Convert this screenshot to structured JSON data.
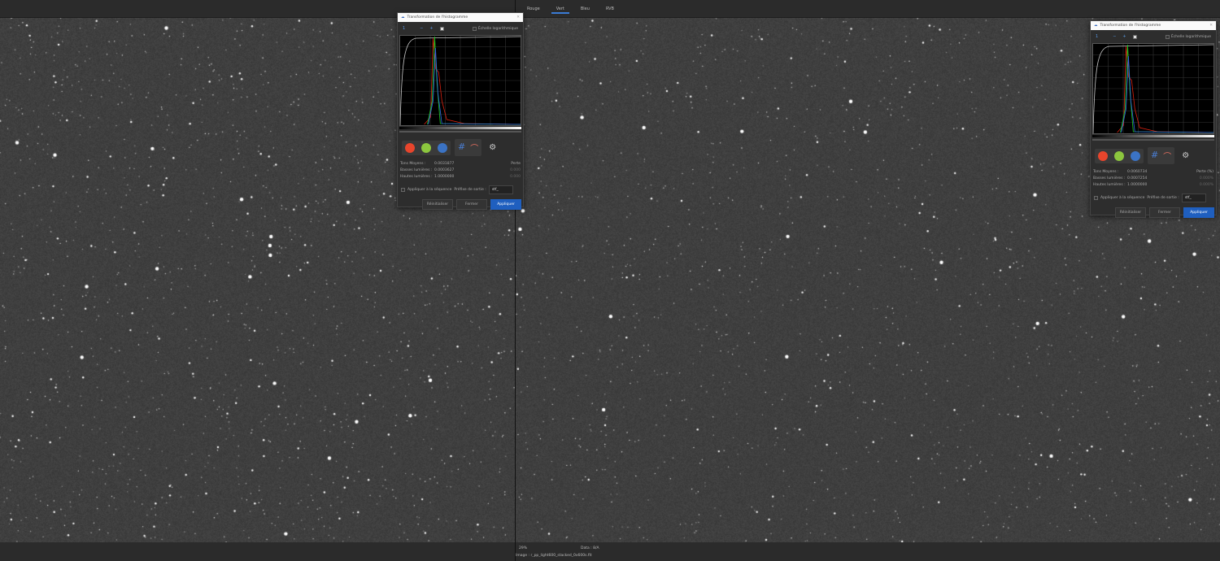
{
  "channel_tabs": [
    "Rouge",
    "Vert",
    "Bleu",
    "RVB"
  ],
  "active_tab": "Vert",
  "status": {
    "zoom": "29%",
    "data": "Data : ",
    "data_value": "8/A",
    "image": "Image : r_pp_light600_stacked_0x600s.fit"
  },
  "dialogs": [
    {
      "title": "Transformation de l'histogramme",
      "zoom_value": "1",
      "log_scale_label": "Échelle logarithmique",
      "stats": [
        {
          "label": "Tons Moyens :",
          "value": "0.0031877"
        },
        {
          "label": "Basses lumières :",
          "value": "0.0003627"
        },
        {
          "label": "Hautes lumières :",
          "value": "1.0000000"
        }
      ],
      "loss_label": "Perte",
      "loss_values": [
        "0.000",
        "0.000"
      ],
      "apply_sequence": "Appliquer à la séquence",
      "prefix_label": "Préfixe de sortie :",
      "prefix_value": "stf_",
      "reset": "Réinitialiser",
      "close": "Fermer",
      "apply": "Appliquer"
    },
    {
      "title": "Transformation de l'histogramme",
      "zoom_value": "1",
      "log_scale_label": "Échelle logarithmique",
      "stats": [
        {
          "label": "Tons Moyens :",
          "value": "0.0060734"
        },
        {
          "label": "Basses lumières :",
          "value": "0.0007254"
        },
        {
          "label": "Hautes lumières :",
          "value": "1.0000000"
        }
      ],
      "loss_label": "Perte (%)",
      "loss_values": [
        "0.000%",
        "0.000%"
      ],
      "apply_sequence": "Appliquer à la séquence",
      "prefix_label": "Préfixe de sortie :",
      "prefix_value": "stf_",
      "reset": "Réinitialiser",
      "close": "Fermer",
      "apply": "Appliquer"
    }
  ],
  "colors": {
    "red": "#e8452c",
    "green": "#8cc63e",
    "blue": "#3b73c4",
    "accent": "#1f5fbf"
  }
}
